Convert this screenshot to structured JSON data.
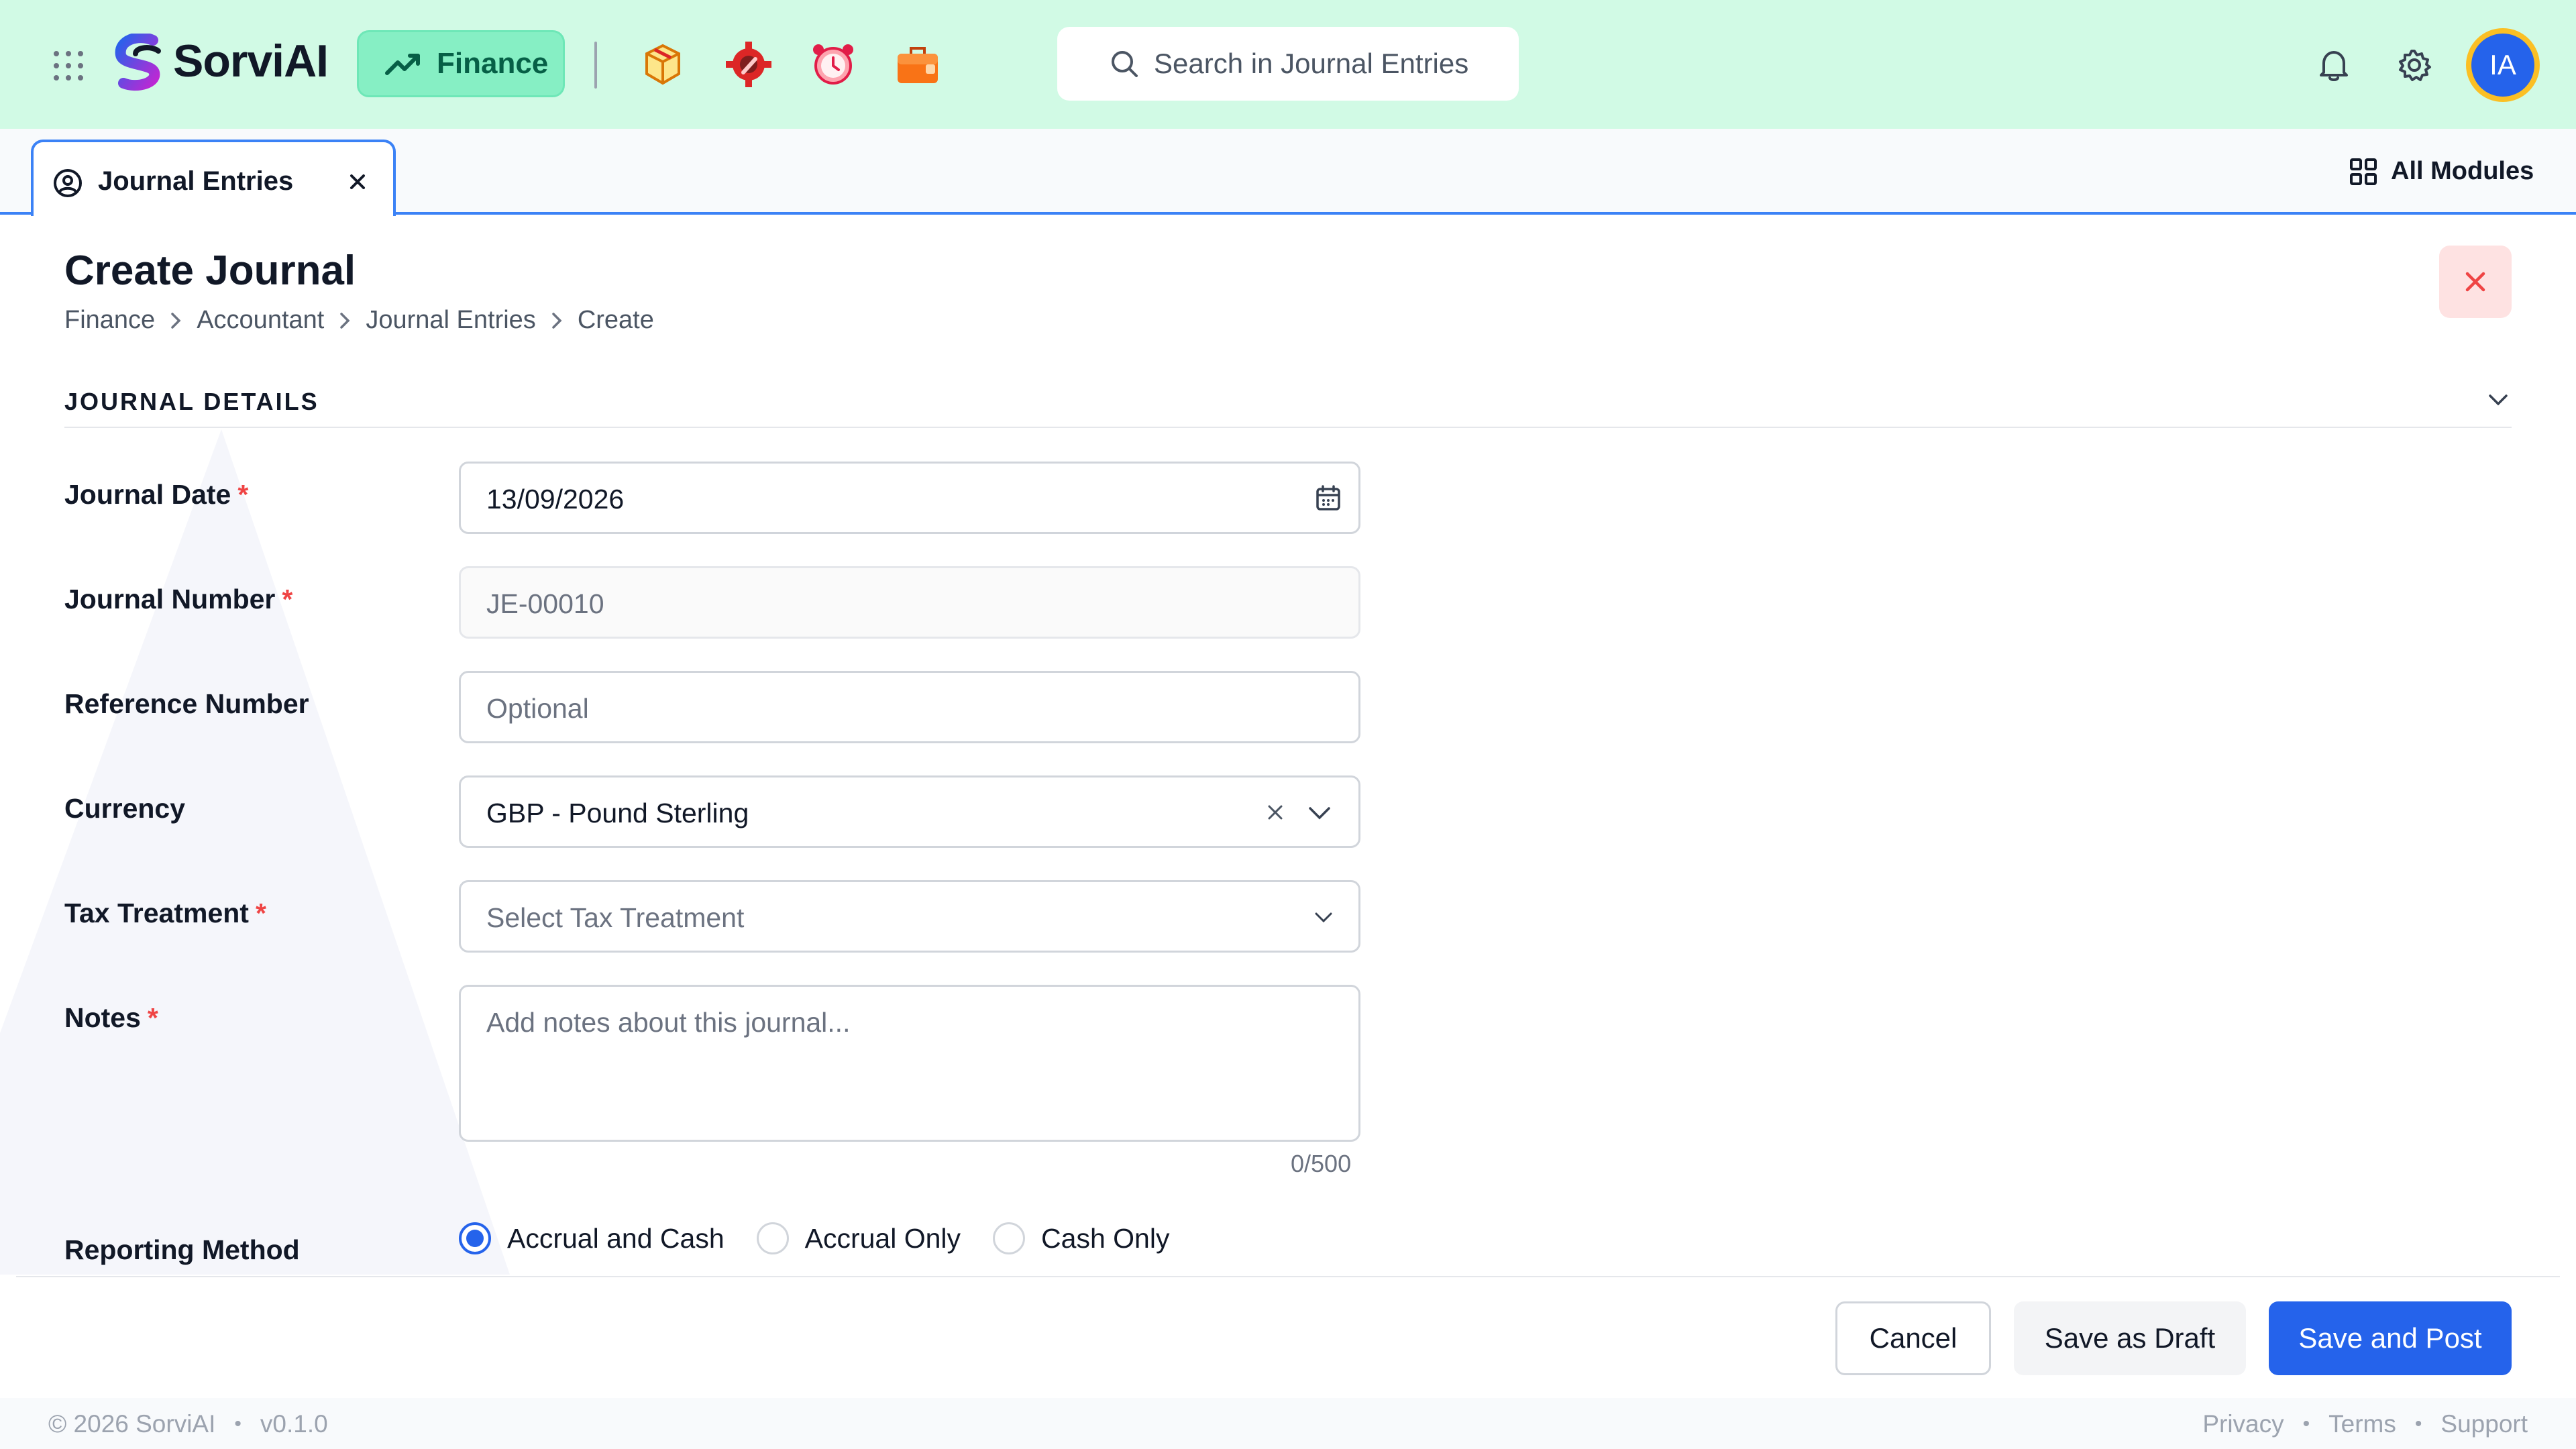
{
  "header": {
    "logo_text": "SorviAI",
    "module_label": "Finance",
    "app_icons": [
      "package-box-icon",
      "gear-wrench-icon",
      "alarm-clock-icon",
      "briefcase-icon"
    ],
    "search_placeholder": "Search in Journal Entries",
    "user_initials": "IA"
  },
  "tabs": {
    "active_tab_label": "Journal Entries",
    "all_modules_label": "All Modules"
  },
  "page": {
    "title": "Create Journal",
    "breadcrumb": [
      "Finance",
      "Accountant",
      "Journal Entries",
      "Create"
    ]
  },
  "section": {
    "title": "JOURNAL DETAILS"
  },
  "form": {
    "journal_date": {
      "label": "Journal Date",
      "value": "13/09/2026",
      "required_mark": "*"
    },
    "journal_number": {
      "label": "Journal Number",
      "placeholder": "JE-00010",
      "required_mark": "*"
    },
    "reference_number": {
      "label": "Reference Number",
      "placeholder": "Optional"
    },
    "currency": {
      "label": "Currency",
      "value": "GBP - Pound Sterling"
    },
    "tax_treatment": {
      "label": "Tax Treatment",
      "placeholder": "Select Tax Treatment",
      "required_mark": "*"
    },
    "notes": {
      "label": "Notes",
      "placeholder": "Add notes about this journal...",
      "counter": "0/500",
      "required_mark": "*"
    },
    "reporting_method": {
      "label": "Reporting Method",
      "options": [
        "Accrual and Cash",
        "Accrual Only",
        "Cash Only"
      ],
      "selected": "Accrual and Cash"
    }
  },
  "actions": {
    "cancel": "Cancel",
    "save_draft": "Save as Draft",
    "save_post": "Save and Post"
  },
  "footer": {
    "copyright": "© 2026 SorviAI",
    "version": "v0.1.0",
    "separator": "•",
    "links": [
      "Privacy",
      "Terms",
      "Support"
    ]
  },
  "colors": {
    "topbar_bg": "#d1fae5",
    "accent_blue": "#2563eb",
    "required_red": "#ef4444",
    "finance_pill": "#86efc4"
  }
}
